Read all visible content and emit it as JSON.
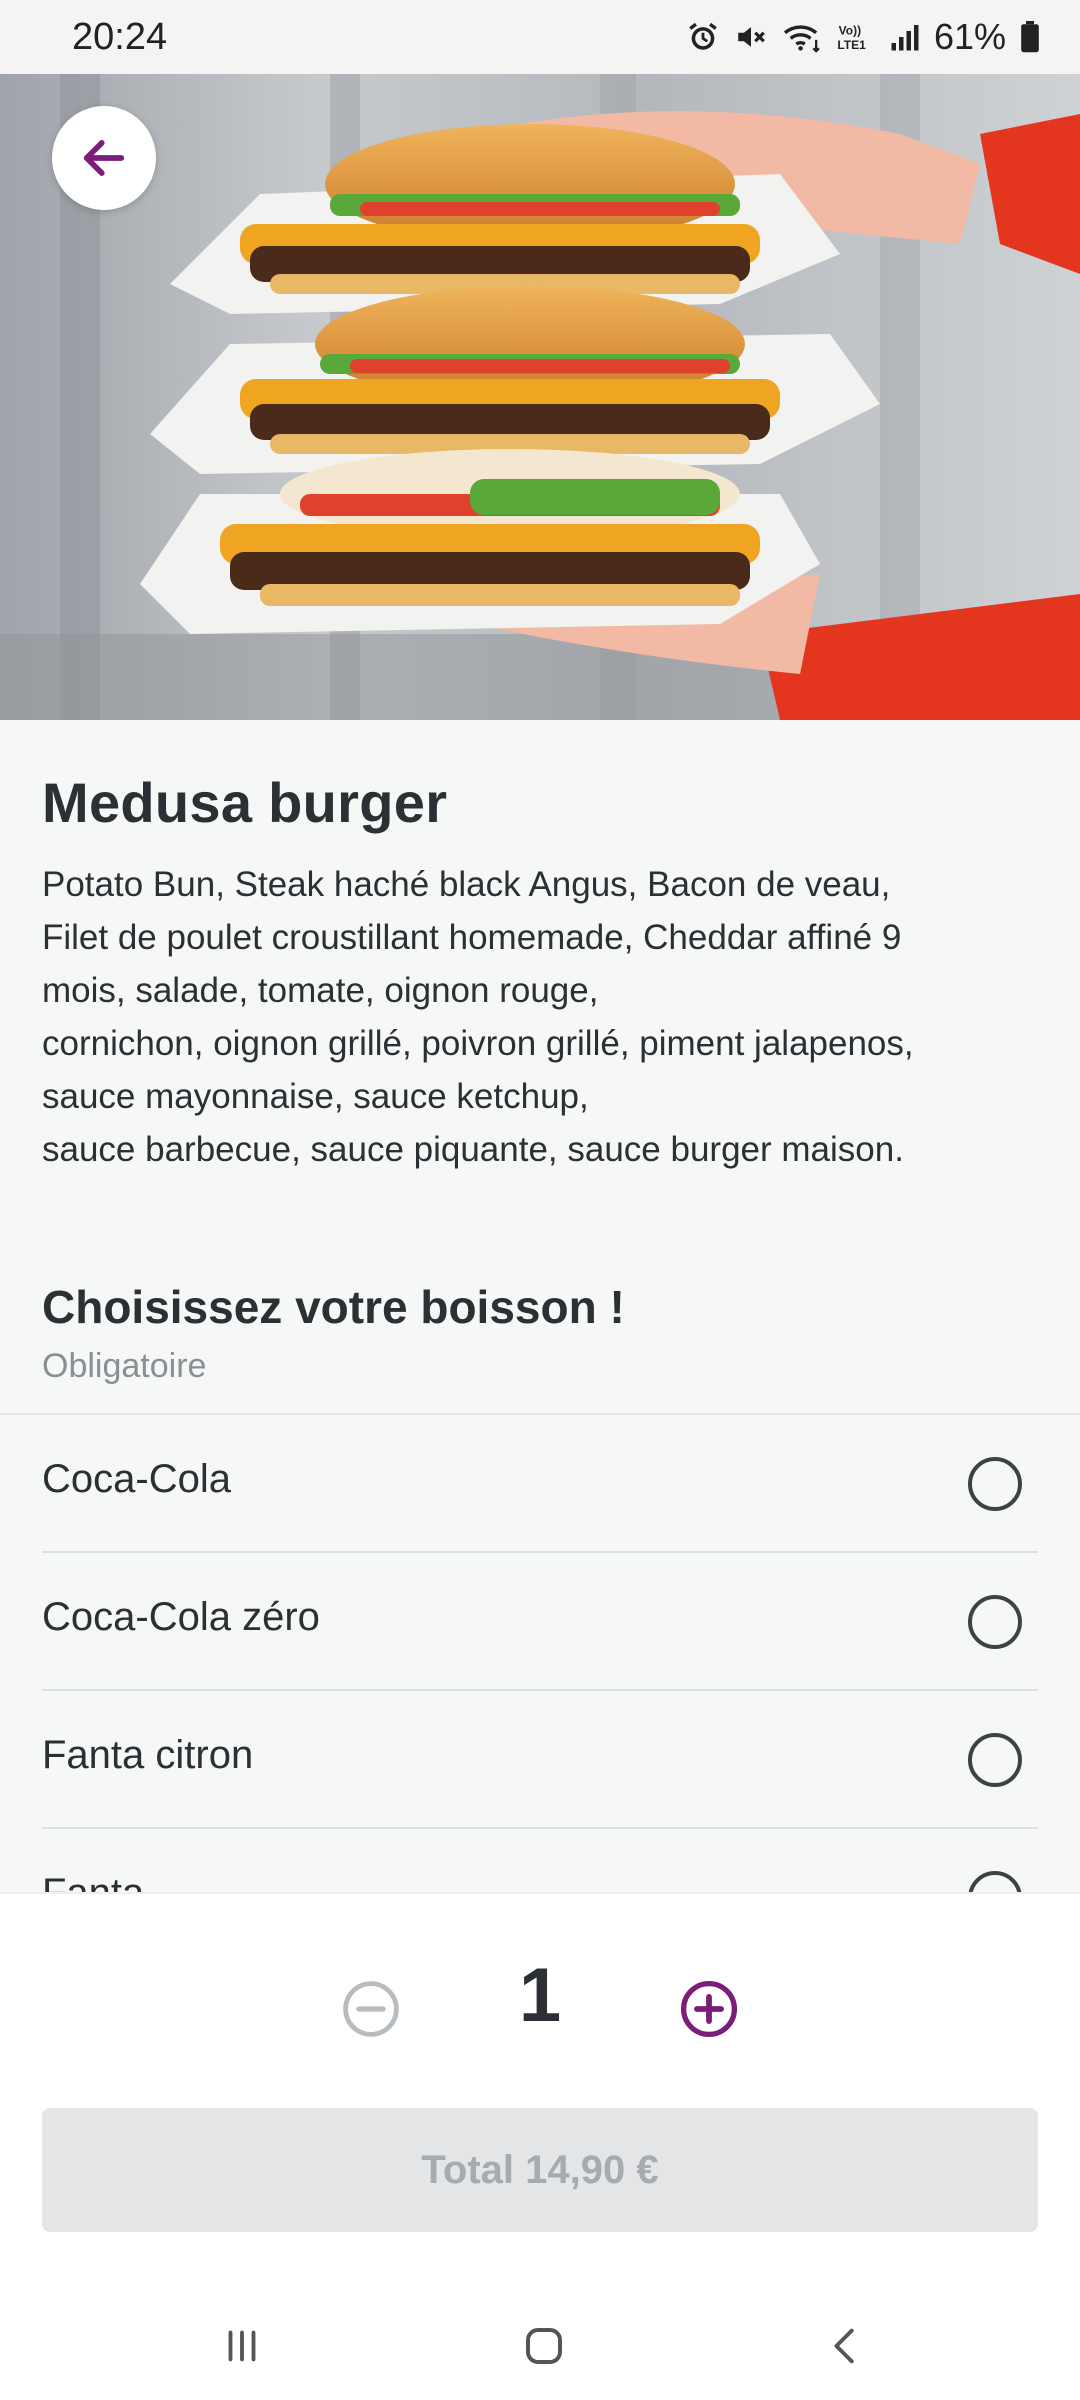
{
  "status_bar": {
    "time": "20:24",
    "battery": "61%",
    "icons": [
      "alarm-icon",
      "mute-icon",
      "wifi-icon",
      "volte-icon",
      "signal-icon",
      "battery-icon"
    ]
  },
  "hero": {
    "image": "burger-photo",
    "back_icon": "arrow-left-icon"
  },
  "product": {
    "title": "Medusa burger",
    "description_lines": [
      "Potato Bun, Steak haché black Angus, Bacon de veau,",
      "Filet de poulet croustillant homemade, Cheddar affiné 9",
      "mois, salade, tomate, oignon rouge,",
      "cornichon, oignon grillé, poivron grillé, piment jalapenos,",
      "sauce mayonnaise, sauce ketchup,",
      "sauce barbecue, sauce piquante, sauce burger maison."
    ]
  },
  "drink_section": {
    "title": "Choisissez votre boisson !",
    "subtitle": "Obligatoire",
    "options": [
      {
        "label": "Coca-Cola",
        "selected": false
      },
      {
        "label": "Coca-Cola zéro",
        "selected": false
      },
      {
        "label": "Fanta citron",
        "selected": false
      },
      {
        "label": "Fanta",
        "selected": false
      }
    ]
  },
  "quantity": {
    "value": "1",
    "minus_icon": "minus-circle-icon",
    "plus_icon": "plus-circle-icon"
  },
  "total_button": {
    "label": "Total 14,90 €",
    "enabled": false
  },
  "nav_bar": {
    "items": [
      "recent-apps-icon",
      "home-icon",
      "back-icon"
    ]
  },
  "colors": {
    "accent": "#7b1e7a",
    "disabled": "#b7bcc1",
    "text": "#2c2f33",
    "muted": "#8a8f94"
  }
}
